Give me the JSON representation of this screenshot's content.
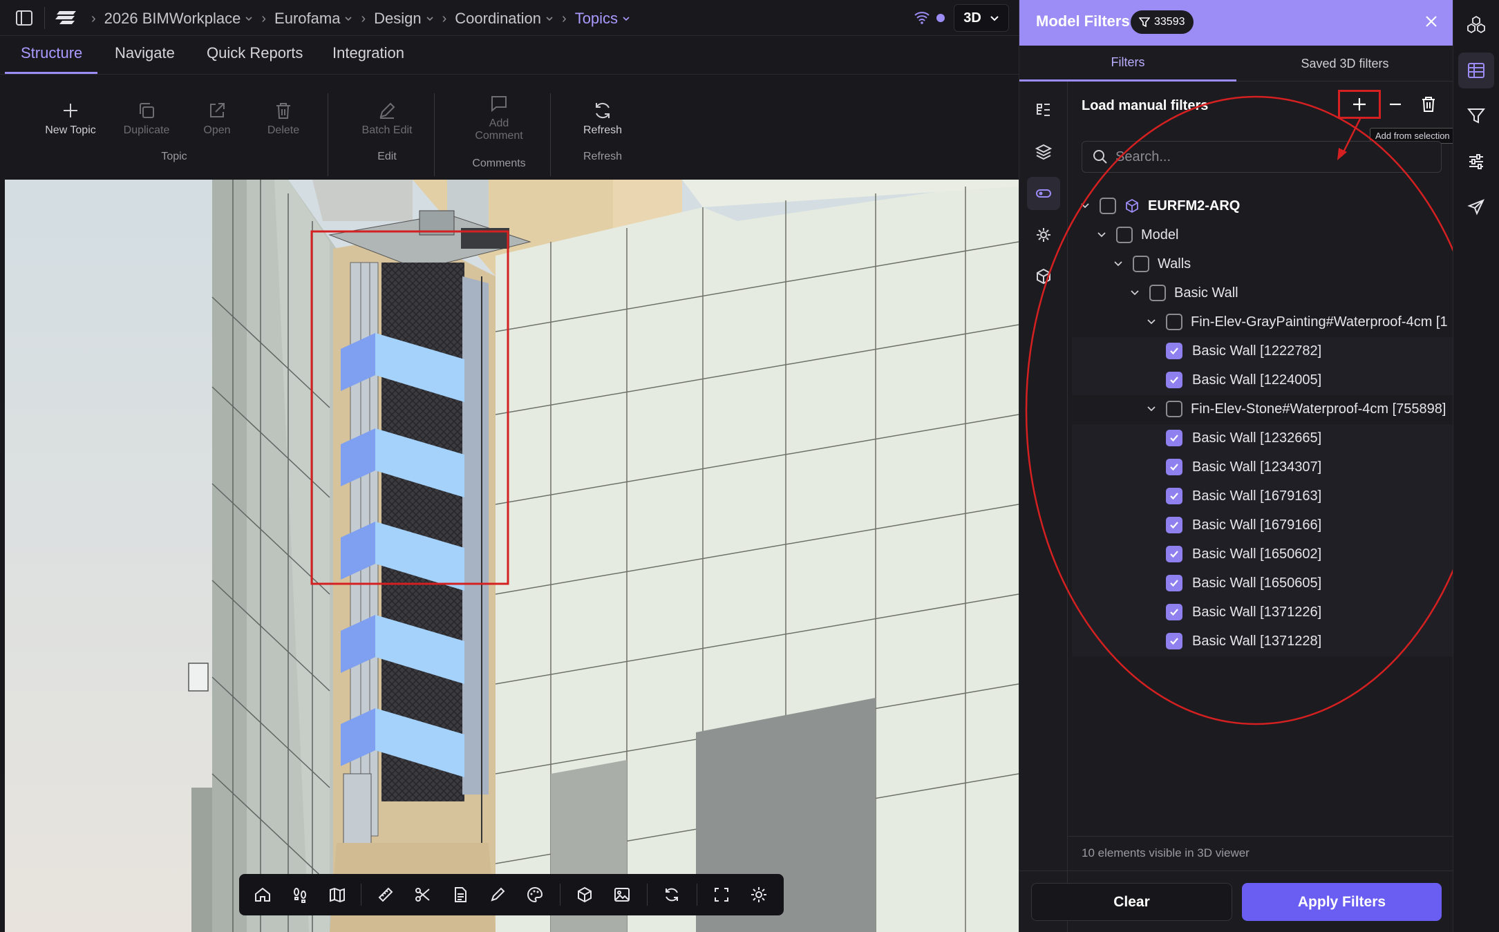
{
  "breadcrumb": {
    "items": [
      "2026 BIMWorkplace",
      "Eurofama",
      "Design",
      "Coordination",
      "Topics"
    ],
    "view_mode": "3D"
  },
  "tabs": [
    "Structure",
    "Navigate",
    "Quick Reports",
    "Integration"
  ],
  "ribbon": {
    "buttons": {
      "new_topic": "New Topic",
      "duplicate": "Duplicate",
      "open": "Open",
      "delete": "Delete",
      "batch_edit": "Batch Edit",
      "add_comment_1": "Add",
      "add_comment_2": "Comment",
      "refresh": "Refresh"
    },
    "groups": {
      "topic": "Topic",
      "edit": "Edit",
      "comments": "Comments",
      "refresh": "Refresh"
    }
  },
  "panel": {
    "title": "Model Filters",
    "filter_count": "33593",
    "tabs": [
      "Filters",
      "Saved 3D filters"
    ],
    "section_title": "Load manual filters",
    "tooltip": "Add from selection",
    "search_placeholder": "Search...",
    "tree": [
      {
        "label": "EURFM2-ARQ",
        "checked": false
      },
      {
        "label": "Model",
        "checked": false
      },
      {
        "label": "Walls",
        "checked": false
      },
      {
        "label": "Basic Wall",
        "checked": false
      },
      {
        "label": "Fin-Elev-GrayPainting#Waterproof-4cm [1",
        "checked": false
      },
      {
        "label": "Basic Wall [1222782]",
        "checked": true
      },
      {
        "label": "Basic Wall [1224005]",
        "checked": true
      },
      {
        "label": "Fin-Elev-Stone#Waterproof-4cm [755898]",
        "checked": false
      },
      {
        "label": "Basic Wall [1232665]",
        "checked": true
      },
      {
        "label": "Basic Wall [1234307]",
        "checked": true
      },
      {
        "label": "Basic Wall [1679163]",
        "checked": true
      },
      {
        "label": "Basic Wall [1679166]",
        "checked": true
      },
      {
        "label": "Basic Wall [1650602]",
        "checked": true
      },
      {
        "label": "Basic Wall [1650605]",
        "checked": true
      },
      {
        "label": "Basic Wall [1371226]",
        "checked": true
      },
      {
        "label": "Basic Wall [1371228]",
        "checked": true
      }
    ],
    "footer_status": "10 elements visible in 3D viewer",
    "clear_label": "Clear",
    "apply_label": "Apply Filters"
  },
  "colors": {
    "accent": "#9c8cf6",
    "apply_button": "#6a5ef2",
    "annotation_red": "#d42020",
    "selection_blue": "#9fd2ff"
  },
  "icons": {
    "sidebar_toggle": "sidebar-toggle-icon",
    "logo": "app-logo-icon",
    "wifi": "wifi-icon",
    "close": "close-icon",
    "funnel": "filter-icon"
  }
}
